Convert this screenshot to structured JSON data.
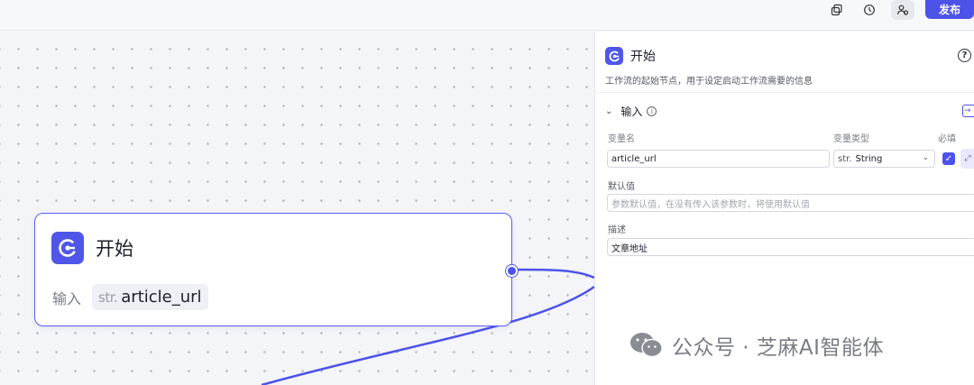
{
  "toolbar": {
    "icons": [
      "copy-icon",
      "history-icon",
      "user-manage-icon"
    ],
    "publish_label": "发布"
  },
  "node": {
    "title": "开始",
    "input_label": "输入",
    "type_tag": "str.",
    "param": "article_url"
  },
  "panel": {
    "title": "开始",
    "help": "?",
    "description": "工作流的起始节点，用于设定启动工作流需要的信息",
    "section_title": "输入",
    "columns": {
      "name": "变量名",
      "type": "变量类型",
      "required": "必填"
    },
    "variable": {
      "name": "article_url",
      "type_prefix": "str.",
      "type": "String",
      "required": true
    },
    "default_label": "默认值",
    "default_placeholder": "参数默认值，在没有传入该参数时，将使用默认值",
    "desc_label": "描述",
    "desc_value": "文章地址"
  },
  "watermark": {
    "text": "公众号 · 芝麻AI智能体"
  },
  "colors": {
    "accent": "#4d53e8",
    "canvas": "#f4f5f8",
    "border": "#d5d7de"
  }
}
